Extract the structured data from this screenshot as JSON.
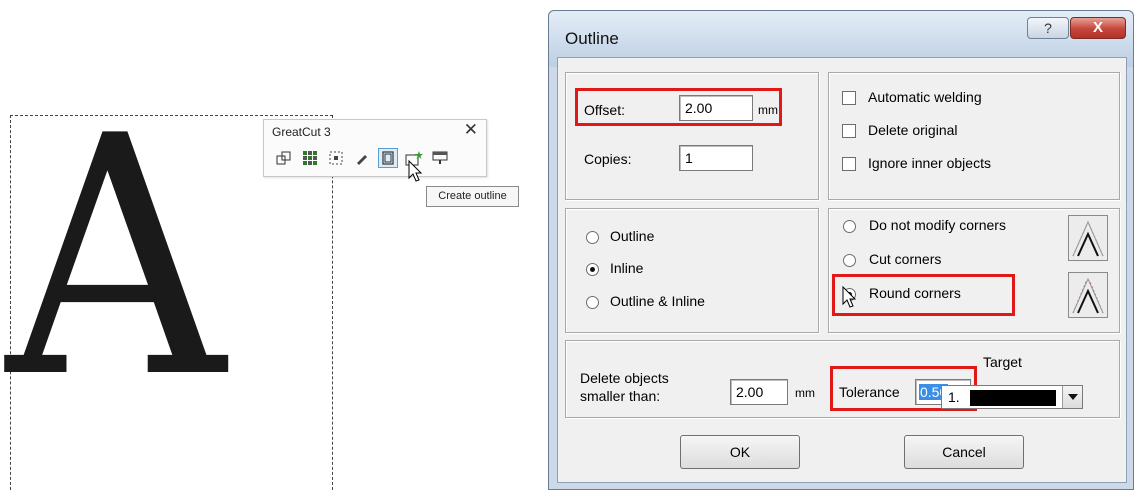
{
  "canvas": {
    "letter": "A"
  },
  "toolbar": {
    "title": "GreatCut 3",
    "close_glyph": "✕",
    "icons": [
      "weld-icon",
      "grid-icon",
      "select-frame-icon",
      "pen-icon",
      "create-outline-icon",
      "add-star-icon",
      "monitor-icon"
    ],
    "tooltip": "Create outline"
  },
  "dialog": {
    "title": "Outline",
    "help_glyph": "?",
    "close_glyph": "X",
    "offset_label": "Offset:",
    "offset_value": "2.00",
    "offset_unit": "mm",
    "copies_label": "Copies:",
    "copies_value": "1",
    "checks": {
      "auto_weld": "Automatic welding",
      "delete_original": "Delete original",
      "ignore_inner": "Ignore inner objects"
    },
    "mode": {
      "outline": "Outline",
      "inline": "Inline",
      "both": "Outline & Inline",
      "selected": "Inline"
    },
    "corners": {
      "no_modify": "Do not modify corners",
      "cut": "Cut corners",
      "round": "Round corners",
      "selected": "Round corners"
    },
    "delete_label_1": "Delete objects",
    "delete_label_2": "smaller than:",
    "delete_value": "2.00",
    "delete_unit": "mm",
    "tolerance_label": "Tolerance",
    "tolerance_value": "0.50",
    "target_label": "Target",
    "target_value": "1.",
    "target_color": "#000000",
    "ok": "OK",
    "cancel": "Cancel"
  },
  "colors": {
    "highlight_red": "#e01818",
    "title_bar": "#cdd9e8"
  }
}
